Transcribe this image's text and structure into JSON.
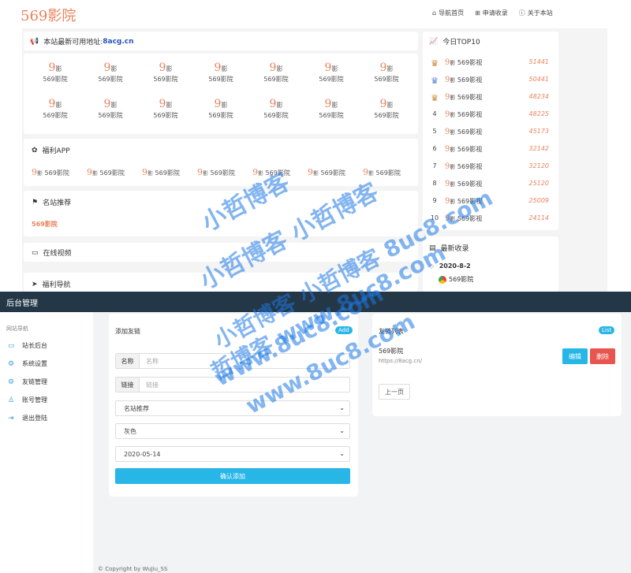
{
  "header": {
    "logo": "569影院",
    "nav": [
      {
        "icon": "home-icon",
        "glyph": "⌂",
        "label": "导航首页"
      },
      {
        "icon": "plus-square-icon",
        "glyph": "⊞",
        "label": "申请收录"
      },
      {
        "icon": "info-icon",
        "glyph": "ⓘ",
        "label": "关于本站"
      }
    ]
  },
  "notice": {
    "text": "本站最新可用地址:",
    "link": "8acg.cn"
  },
  "tiles": {
    "mark": "9",
    "mark_small": "影",
    "name": "569影院"
  },
  "fuli_app": {
    "title": "福利APP",
    "item": "569影院"
  },
  "famous": {
    "title": "名站推荐",
    "item": "569影院"
  },
  "online_video": {
    "title": "在线视频"
  },
  "fuli_nav": {
    "title": "福利导航"
  },
  "top10": {
    "title": "今日TOP10",
    "rows": [
      {
        "rank": "♛",
        "name": "569影视",
        "count": "51441"
      },
      {
        "rank": "♛",
        "name": "569影视",
        "count": "50441"
      },
      {
        "rank": "♛",
        "name": "569影视",
        "count": "48234"
      },
      {
        "rank": "4",
        "name": "569影视",
        "count": "48225"
      },
      {
        "rank": "5",
        "name": "569影视",
        "count": "45173"
      },
      {
        "rank": "6",
        "name": "569影视",
        "count": "32142"
      },
      {
        "rank": "7",
        "name": "569影视",
        "count": "32120"
      },
      {
        "rank": "8",
        "name": "569影视",
        "count": "25120"
      },
      {
        "rank": "9",
        "name": "569影视",
        "count": "25009"
      },
      {
        "rank": "10",
        "name": "569影视",
        "count": "24114"
      }
    ],
    "crown_colors": [
      "#c9842f",
      "#5b7bd8",
      "#c9842f"
    ]
  },
  "latest": {
    "title": "最新收录",
    "date": "2020-8-2",
    "item": "569影院"
  },
  "admin": {
    "title": "后台管理",
    "sidebar_heading": "网站导航",
    "sidebar": [
      {
        "icon": "monitor-icon",
        "glyph": "▭",
        "label": "站长后台"
      },
      {
        "icon": "gear-icon",
        "glyph": "⚙",
        "label": "系统设置"
      },
      {
        "icon": "gear-icon",
        "glyph": "⚙",
        "label": "友链管理"
      },
      {
        "icon": "user-icon",
        "glyph": "♙",
        "label": "账号管理"
      },
      {
        "icon": "logout-icon",
        "glyph": "⇥",
        "label": "退出登陆"
      }
    ],
    "add_panel": {
      "title": "添加友链",
      "badge": "Add",
      "name_label": "名称",
      "name_placeholder": "名称",
      "link_label": "链接",
      "link_placeholder": "链接",
      "category": "名站推荐",
      "color": "灰色",
      "date": "2020-05-14",
      "submit": "确认添加"
    },
    "list_panel": {
      "title": "友链列表",
      "badge": "List",
      "item_name": "569影院",
      "item_url": "https://8acg.cn/",
      "edit": "编辑",
      "delete": "删除",
      "prev": "上一页"
    },
    "footer": "© Copyright by WuJiu_SS"
  },
  "watermark": {
    "line1": "小哲博客",
    "line2": "小哲博客 小哲博客",
    "line3": "小哲博客 小哲博客 8uc8.com",
    "line4": "哲博客 www.8uc8.com",
    "line5": "www.8uc8.com",
    "line6": "www.8uc8.com"
  },
  "colors": {
    "accent": "#e9835d",
    "primary": "#27b6e6",
    "danger": "#e8544e",
    "dark": "#243746"
  }
}
